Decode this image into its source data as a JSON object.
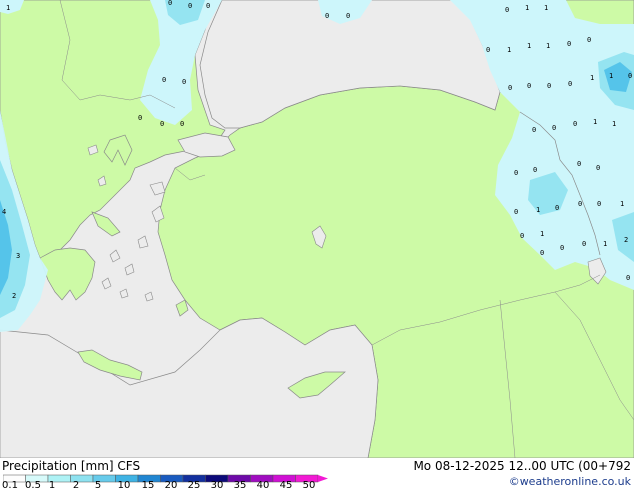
{
  "header": {
    "title": "Precipitation [mm]  CFS",
    "datetime": "Mo 08-12-2025 12..00 UTC (00+792",
    "credit": "©weatheronline.co.uk"
  },
  "legend": {
    "ticks": [
      "0.1",
      "0.5",
      "1",
      "2",
      "5",
      "10",
      "15",
      "20",
      "25",
      "30",
      "35",
      "40",
      "45",
      "50"
    ],
    "colors": [
      "#fdfdfd",
      "#d7fafa",
      "#aef2f5",
      "#8ee2f0",
      "#67cbeb",
      "#3fb3e4",
      "#2186d2",
      "#1a5bbf",
      "#13309e",
      "#0c0a7a",
      "#6e0aa8",
      "#a00dc0",
      "#d010d4",
      "#f21ad4"
    ]
  },
  "map": {
    "colors": {
      "sea": "#ececec",
      "land": "#cdfaa6",
      "precip_light": "#cdf6fb",
      "precip_medium": "#95e4f1",
      "precip_heavy": "#55c4ea",
      "coast": "#8a8a8a"
    },
    "grid_labels": [
      "0",
      "1",
      "2",
      "3",
      "4"
    ]
  }
}
